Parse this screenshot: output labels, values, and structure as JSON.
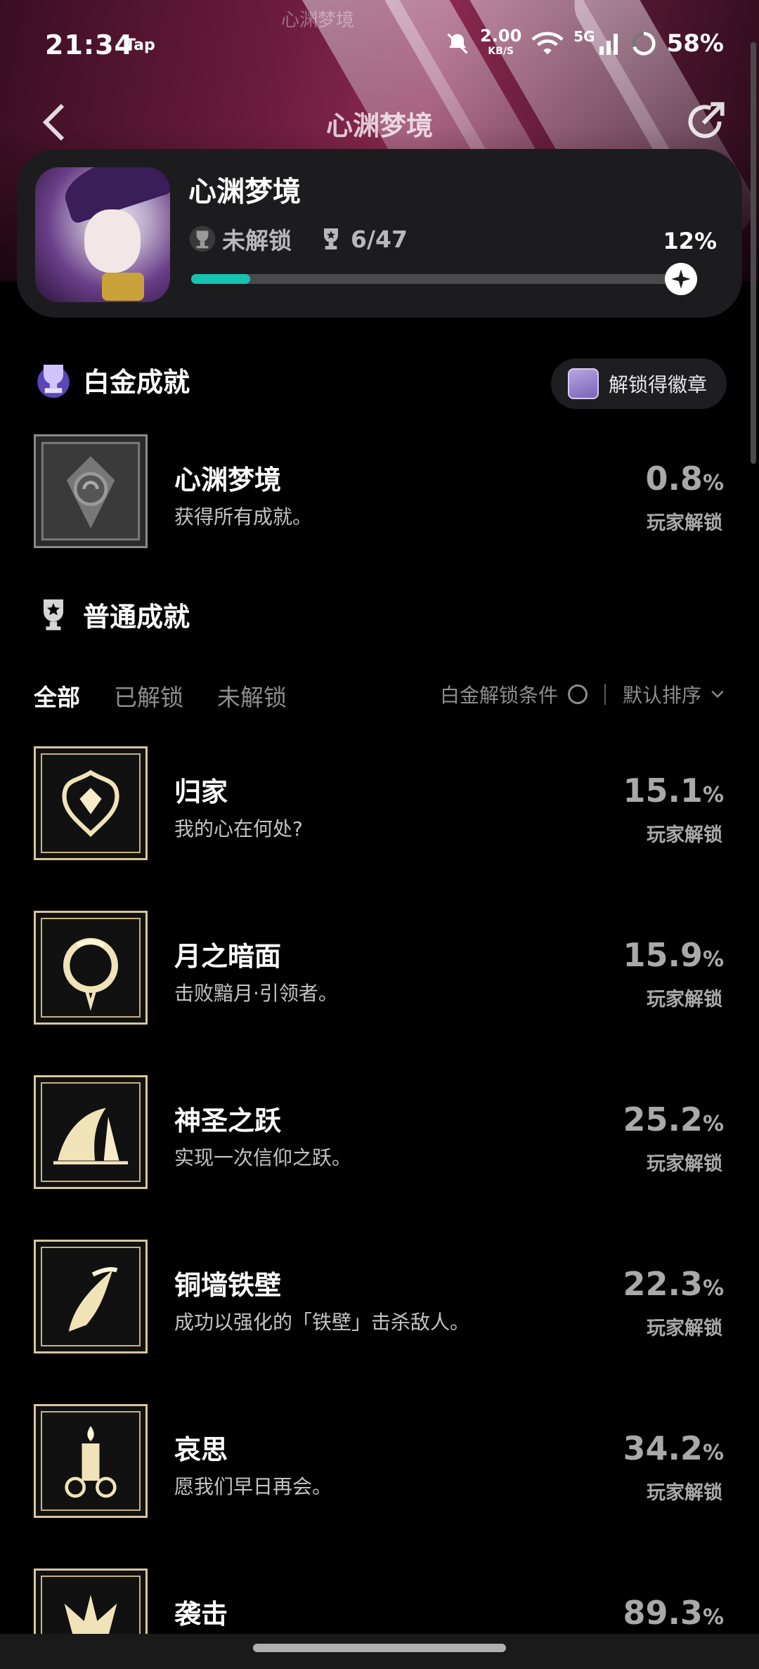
{
  "watermark": "心渊梦境",
  "status_bar": {
    "time": "21:34",
    "app_tag": "Tap",
    "net_speed": "2.00",
    "net_unit": "KB/S",
    "network": "5G",
    "battery": "58%"
  },
  "nav": {
    "title": "心渊梦境"
  },
  "summary": {
    "title": "心渊梦境",
    "lock_label": "未解锁",
    "count": "6/47",
    "percent": "12%",
    "progress": 0.12
  },
  "platinum": {
    "heading": "白金成就",
    "badge_button": "解锁得徽章",
    "item": {
      "name": "心渊梦境",
      "desc": "获得所有成就。",
      "pct": "0.8",
      "unit": "%",
      "sub": "玩家解锁"
    }
  },
  "normal": {
    "heading": "普通成就",
    "tabs": [
      "全部",
      "已解锁",
      "未解锁"
    ],
    "filter_label": "白金解锁条件",
    "sort_label": "默认排序"
  },
  "achievements": [
    {
      "name": "归家",
      "desc": "我的心在何处?",
      "pct": "15.1",
      "unit": "%",
      "sub": "玩家解锁",
      "icon": "heart-shield-icon"
    },
    {
      "name": "月之暗面",
      "desc": "击败黯月·引领者。",
      "pct": "15.9",
      "unit": "%",
      "sub": "玩家解锁",
      "icon": "moon-ring-icon"
    },
    {
      "name": "神圣之跃",
      "desc": "实现一次信仰之跃。",
      "pct": "25.2",
      "unit": "%",
      "sub": "玩家解锁",
      "icon": "leap-icon"
    },
    {
      "name": "铜墙铁壁",
      "desc": "成功以强化的「铁壁」击杀敌人。",
      "pct": "22.3",
      "unit": "%",
      "sub": "玩家解锁",
      "icon": "blade-icon"
    },
    {
      "name": "哀思",
      "desc": "愿我们早日再会。",
      "pct": "34.2",
      "unit": "%",
      "sub": "玩家解锁",
      "icon": "candle-icon"
    },
    {
      "name": "袭击",
      "desc": "",
      "pct": "89.3",
      "unit": "%",
      "sub": "",
      "icon": "beast-icon"
    }
  ],
  "colors": {
    "accent": "#17c2b3",
    "background": "#000000",
    "card": "#1c1c1e"
  }
}
